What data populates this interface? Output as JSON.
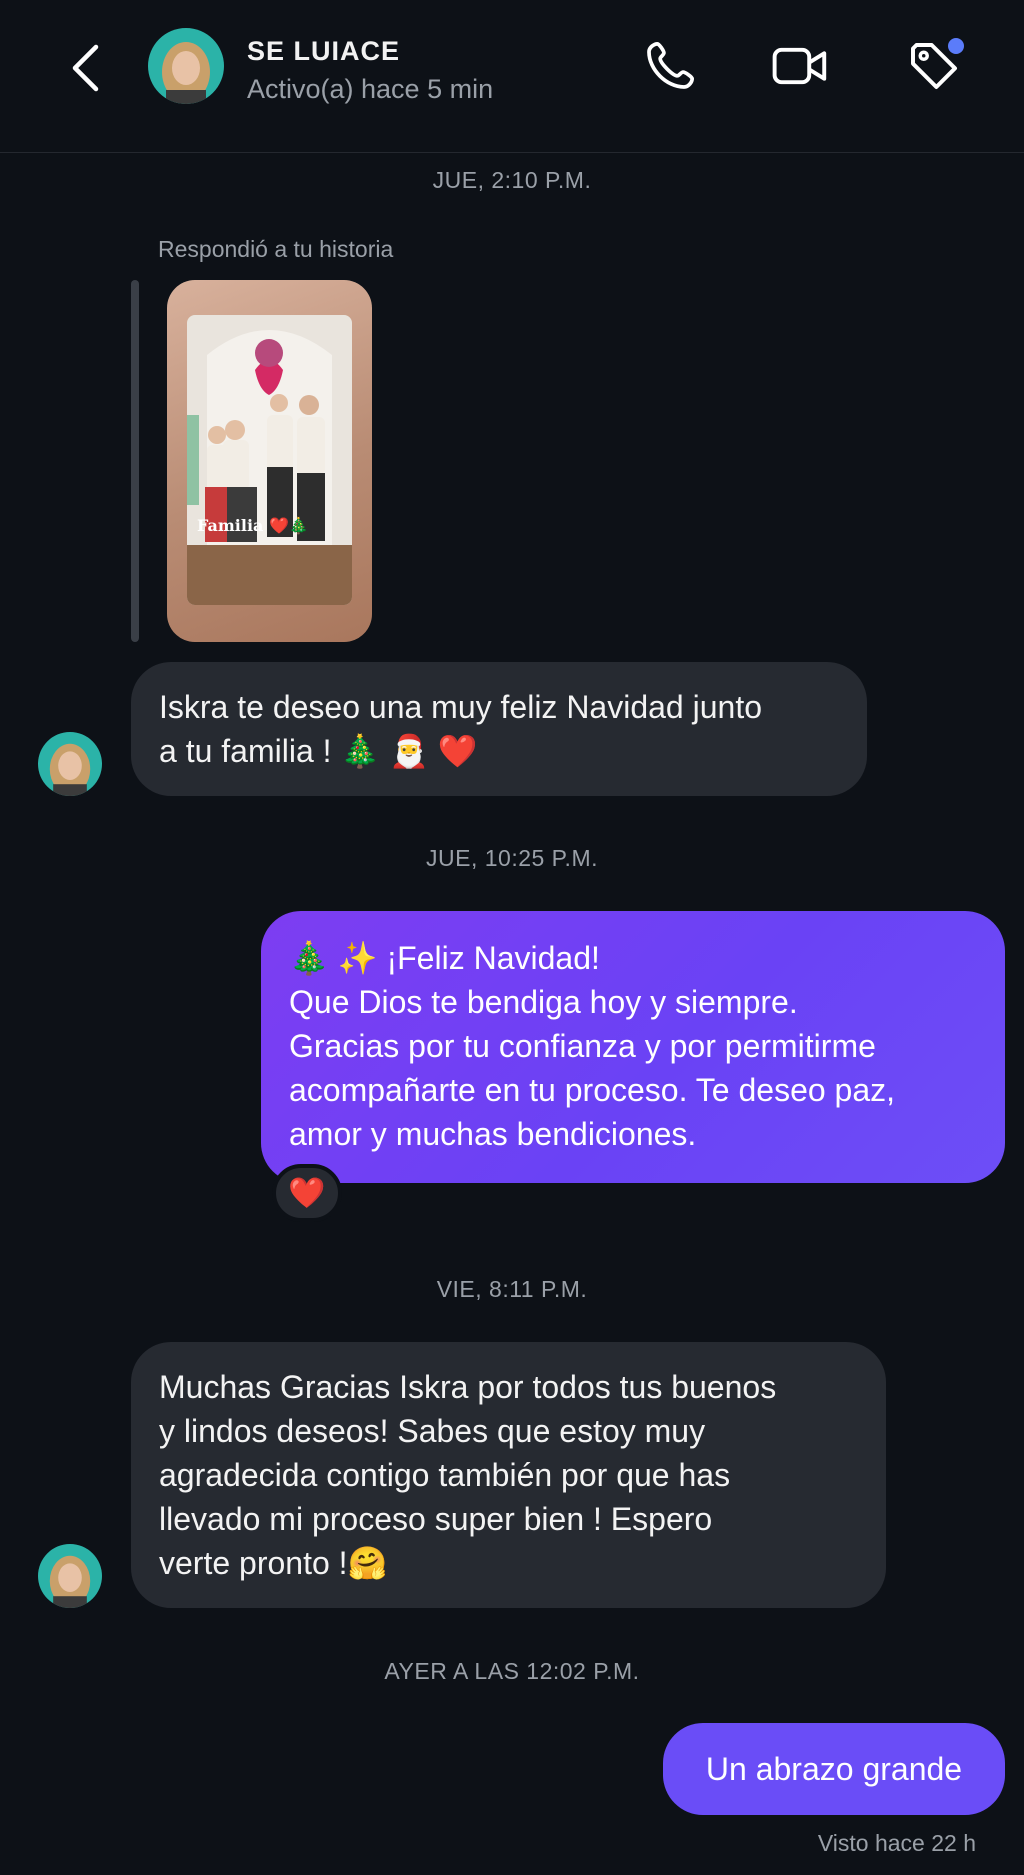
{
  "header": {
    "contact_name": "SE LUIACE",
    "status": "Activo(a) hace 5 min"
  },
  "colors": {
    "background": "#0d1117",
    "incoming_bubble": "#262a31",
    "outgoing_bubble": "#7d3df2",
    "notification_dot": "#5b7cfa",
    "muted_text": "#9aa0a8"
  },
  "icons": {
    "back": "chevron-left-icon",
    "call": "phone-icon",
    "video": "video-camera-icon",
    "tag": "tag-icon"
  },
  "messages": {
    "ts1": "JUE, 2:10 P.M.",
    "reply_note": "Respondió a tu historia",
    "story_caption": "Familia ❤️🎄",
    "msg1": {
      "line1": "Iskra te deseo una muy feliz Navidad junto",
      "line2": "a tu familia ! 🎄 🎅 ❤️"
    },
    "ts2": "JUE, 10:25 P.M.",
    "msg2": {
      "line1": "🎄 ✨ ¡Feliz Navidad!",
      "line2": "Que Dios te bendiga hoy y siempre.",
      "line3": "Gracias por tu confianza y por permitirme",
      "line4": "acompañarte en tu proceso. Te deseo paz,",
      "line5": "amor y muchas bendiciones."
    },
    "reaction": "❤️",
    "ts3": "VIE, 8:11 P.M.",
    "msg3": {
      "line1": "Muchas Gracias Iskra por todos tus buenos",
      "line2": "y lindos deseos! Sabes que estoy muy",
      "line3": "agradecida contigo también por que has",
      "line4": "llevado mi proceso super bien ! Espero",
      "line5": "verte pronto !🤗"
    },
    "ts4": "AYER A LAS 12:02 P.M.",
    "msg4": "Un abrazo grande",
    "seen": "Visto hace 22 h"
  }
}
